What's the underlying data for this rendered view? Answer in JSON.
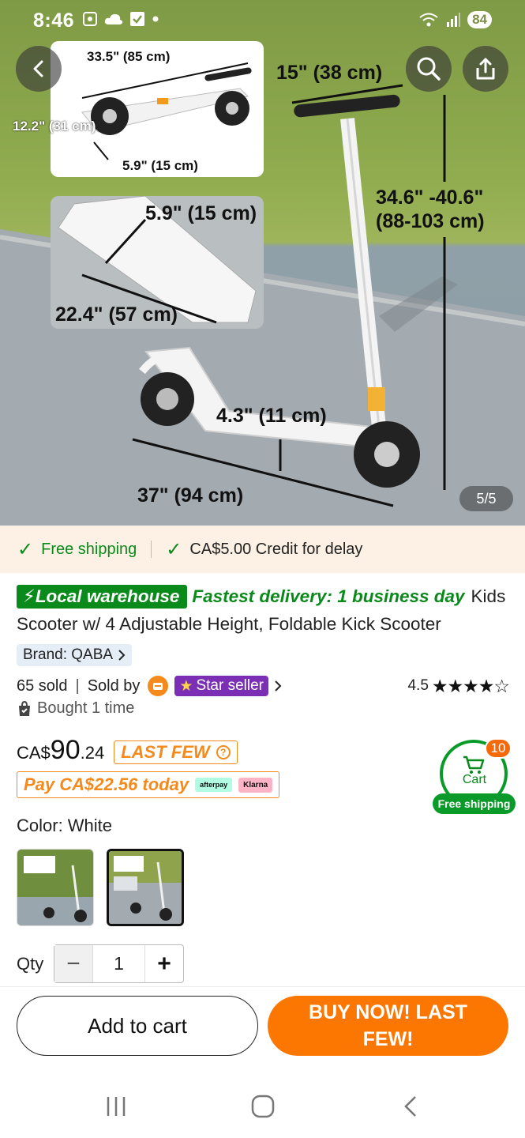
{
  "status_bar": {
    "time": "8:46",
    "battery": "84"
  },
  "gallery": {
    "counter": "5/5",
    "dims": {
      "top_length": "33.5\" (85 cm)",
      "fold_height": "12.2\" (31 cm)",
      "fold_lower": "5.9\" (15 cm)",
      "handlebar": "15\" (38 cm)",
      "height_range_1": "34.6\" -40.6\"",
      "height_range_2": "(88-103 cm)",
      "deck_width": "5.9\" (15 cm)",
      "deck_length": "22.4\" (57 cm)",
      "deck_clearance": "4.3\" (11 cm)",
      "total_length": "37\" (94 cm)"
    }
  },
  "benefits": {
    "free_shipping": "Free shipping",
    "credit": "CA$5.00 Credit for delay"
  },
  "product": {
    "badge": "Local warehouse",
    "fastest": "Fastest delivery: 1 business day",
    "title": "Kids Scooter w/ 4 Adjustable Height, Foldable Kick Scooter",
    "brand": "Brand: QABA",
    "sold": "65 sold",
    "sold_by": "Sold by",
    "star_seller": "Star seller",
    "rating": "4.5",
    "rating_value": 4.5,
    "bought": "Bought 1 time",
    "price_currency": "CA$",
    "price_whole": "90",
    "price_cents": ".24",
    "stock_tag": "LAST FEW",
    "pay_today": "Pay CA$22.56 today",
    "afterpay": "afterpay",
    "klarna": "Klarna",
    "color_label": "Color: White",
    "qty_label": "Qty",
    "qty_value": "1"
  },
  "cart": {
    "label": "Cart",
    "count": "10",
    "shipping": "Free shipping"
  },
  "actions": {
    "add_to_cart": "Add to cart",
    "buy_now": "BUY NOW! LAST FEW!"
  },
  "colors": {
    "accent_orange": "#fb7701",
    "accent_green": "#0a8a1a",
    "star_seller_purple": "#7b2fb4"
  }
}
